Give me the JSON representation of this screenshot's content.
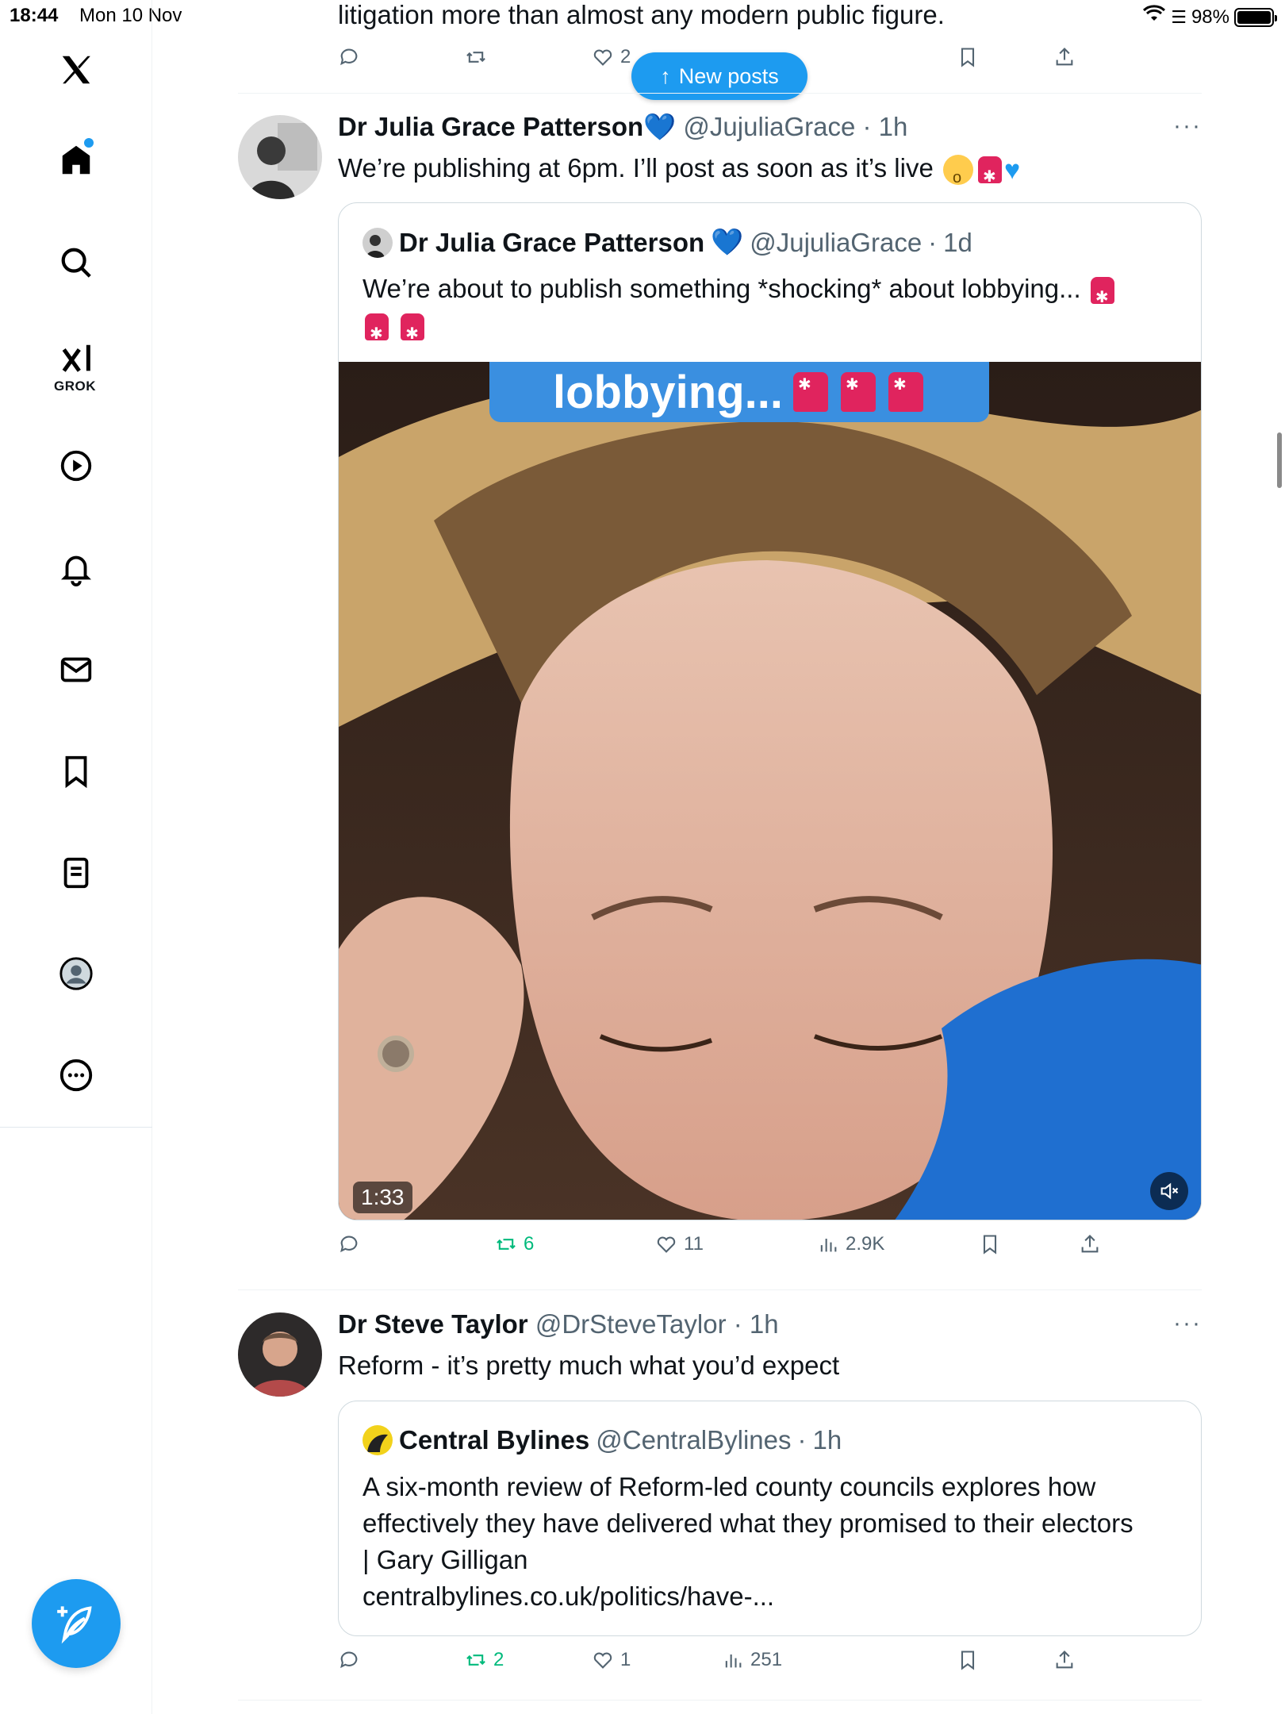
{
  "status_bar": {
    "time": "18:44",
    "date": "Mon 10 Nov",
    "battery": "98%"
  },
  "sidebar": {
    "items": [
      "home",
      "explore",
      "grok",
      "video",
      "notifications",
      "messages",
      "bookmarks",
      "lists",
      "profile",
      "more"
    ],
    "grok_label": "GROK",
    "active": "home"
  },
  "new_posts": {
    "label": "New posts"
  },
  "previous_tweet": {
    "text": "litigation more than almost any modern public figure.",
    "likes": "2"
  },
  "tweets": [
    {
      "author_name": "Dr Julia Grace Patterson",
      "handle": "@JujuliaGrace",
      "time": "1h",
      "text": "We’re publishing at 6pm. I’ll post as soon as it’s live",
      "quote": {
        "author_name": "Dr Julia Grace Patterson",
        "handle": "@JujuliaGrace",
        "time": "1d",
        "text": "We’re about to publish something *shocking* about lobbying...",
        "video_caption": "lobbying...",
        "duration": "1:33"
      },
      "stats": {
        "replies": "",
        "reposts": "6",
        "likes": "11",
        "views": "2.9K"
      }
    },
    {
      "author_name": "Dr Steve Taylor",
      "handle": "@DrSteveTaylor",
      "time": "1h",
      "text": "Reform - it’s pretty much what you’d expect",
      "quote": {
        "author_name": "Central Bylines",
        "handle": "@CentralBylines",
        "time": "1h",
        "text_lines": [
          "A six-month review of Reform-led county councils explores how",
          "effectively they have delivered what they promised to their electors",
          "| Gary Gilligan",
          "centralbylines.co.uk/politics/have-..."
        ]
      },
      "stats": {
        "replies": "",
        "reposts": "2",
        "likes": "1",
        "views": "251"
      }
    }
  ],
  "colors": {
    "accent": "#1d9bf0",
    "repost": "#00ba7c",
    "secondary": "#536471"
  }
}
